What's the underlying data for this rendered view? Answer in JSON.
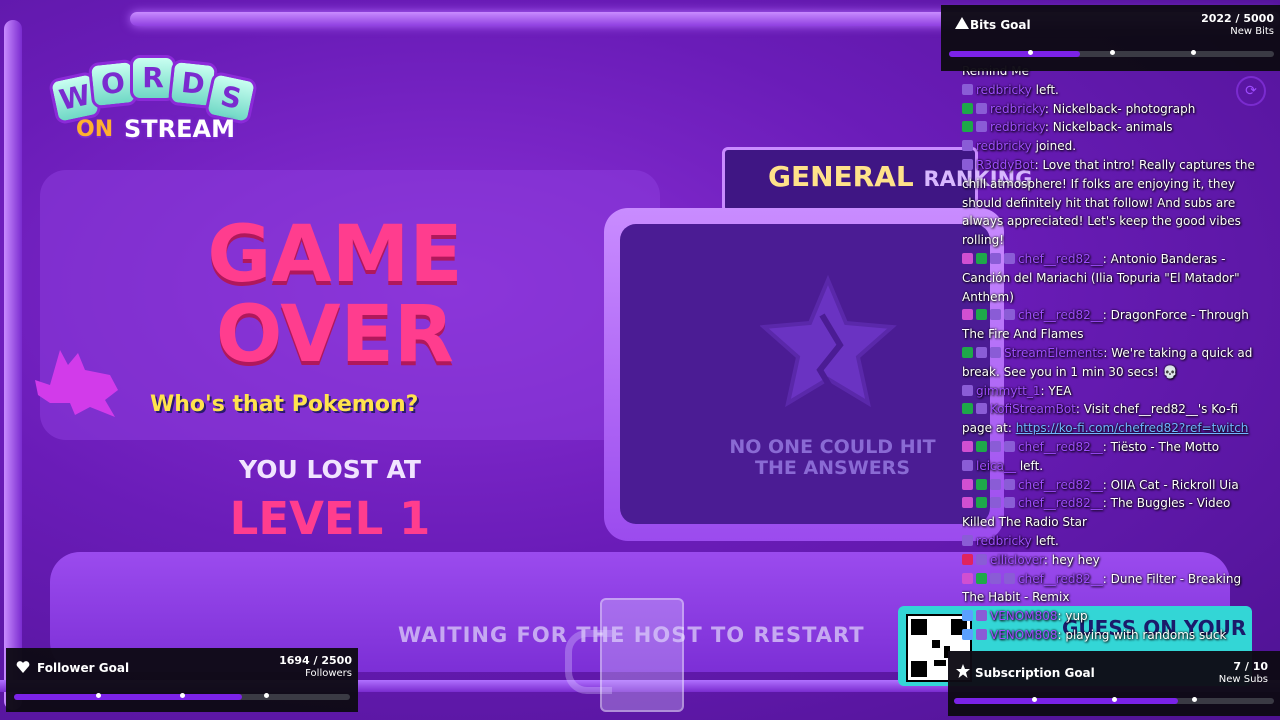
{
  "game": {
    "logo": {
      "letters": [
        "W",
        "O",
        "R",
        "D",
        "S"
      ],
      "on": "ON",
      "stream": "STREAM"
    },
    "game_over": "GAME OVER",
    "pokemon_overlay": "Who's that Pokemon?",
    "you_lost_at": "YOU LOST AT",
    "level": "LEVEL 1",
    "ranking_title": "GENERAL",
    "ranking_title_tail": "RANKING",
    "no_one_message": "NO ONE COULD HIT THE ANSWERS",
    "waiting_message": "WAITING FOR THE HOST TO RESTART",
    "promo_text": "GUESS ON YOUR"
  },
  "goals": {
    "bits": {
      "title": "Bits Goal",
      "current": "2022",
      "target": "5000",
      "unit": "New Bits",
      "progress": 0.4044,
      "ticks": [
        0.25,
        0.5,
        0.75
      ],
      "icon": "bits-icon"
    },
    "followers": {
      "title": "Follower Goal",
      "current": "1694",
      "target": "2500",
      "unit": "Followers",
      "progress": 0.6776,
      "ticks": [
        0.25,
        0.5,
        0.75
      ],
      "icon": "heart-icon"
    },
    "subs": {
      "title": "Subscription Goal",
      "current": "7",
      "target": "10",
      "unit": "New Subs",
      "progress": 0.7,
      "ticks": [
        0.25,
        0.5,
        0.75
      ],
      "icon": "star-icon"
    }
  },
  "chat": {
    "messages": [
      {
        "badges": [],
        "user": "",
        "sep": "",
        "text": "Remind Me"
      },
      {
        "badges": [
          "mod"
        ],
        "user": "redbricky",
        "sep": " ",
        "text": "left."
      },
      {
        "badges": [
          "check",
          "mod"
        ],
        "user": "redbricky",
        "sep": ": ",
        "text": "Nickelback- photograph"
      },
      {
        "badges": [
          "check",
          "mod"
        ],
        "user": "redbricky",
        "sep": ": ",
        "text": "Nickelback- animals"
      },
      {
        "badges": [
          "mod"
        ],
        "user": "redbricky",
        "sep": " ",
        "text": "joined."
      },
      {
        "badges": [
          "mod"
        ],
        "user": "R3ddyBot",
        "sep": ": ",
        "text": "Love that intro! Really captures the chill atmosphere! If folks are enjoying it, they should definitely hit that follow! And subs are always appreciated! Let's keep the good vibes rolling!"
      },
      {
        "badges": [
          "sub",
          "check",
          "mod",
          "mod"
        ],
        "user": "chef__red82__",
        "sep": ": ",
        "text": "Antonio Banderas - Canción del Mariachi (Ilia Topuria \"El Matador\" Anthem)"
      },
      {
        "badges": [
          "sub",
          "check",
          "mod",
          "mod"
        ],
        "user": "chef__red82__",
        "sep": ": ",
        "text": "DragonForce - Through The Fire And Flames"
      },
      {
        "badges": [
          "check",
          "mod",
          "mod"
        ],
        "user": "StreamElements",
        "sep": ": ",
        "text": "We're taking a quick ad break. See you in 1 min 30 secs! 💀"
      },
      {
        "badges": [
          "mod"
        ],
        "user": "gimmytt_1",
        "sep": ": ",
        "text": "YEA"
      },
      {
        "badges": [
          "check",
          "mod"
        ],
        "user": "KofiStreamBot",
        "sep": ": ",
        "text": "Visit chef__red82__'s Ko-fi page at: ",
        "link": "https://ko-fi.com/chefred82?ref=twitch"
      },
      {
        "badges": [
          "sub",
          "check",
          "mod",
          "mod"
        ],
        "user": "chef__red82__",
        "sep": ": ",
        "text": "Tiësto - The Motto"
      },
      {
        "badges": [
          "mod"
        ],
        "user": "leica__",
        "sep": " ",
        "text": "left."
      },
      {
        "badges": [
          "sub",
          "check",
          "mod",
          "mod"
        ],
        "user": "chef__red82__",
        "sep": ": ",
        "text": "OIIA Cat - Rickroll Uia"
      },
      {
        "badges": [
          "sub",
          "check",
          "mod",
          "mod"
        ],
        "user": "chef__red82__",
        "sep": ": ",
        "text": "The Buggles - Video Killed The Radio Star"
      },
      {
        "badges": [
          "mod"
        ],
        "user": "redbricky",
        "sep": " ",
        "text": "left."
      },
      {
        "badges": [
          "heart",
          "mod"
        ],
        "user": "elliclover",
        "sep": ": ",
        "text": "hey hey"
      },
      {
        "badges": [
          "sub",
          "check",
          "mod",
          "mod"
        ],
        "user": "chef__red82__",
        "sep": ": ",
        "text": "Dune Filter - Breaking The Habit - Remix"
      },
      {
        "badges": [
          "vip",
          "mod"
        ],
        "user": "VENOM808",
        "sep": ": ",
        "text": "yup"
      },
      {
        "badges": [
          "vip",
          "mod"
        ],
        "user": "VENOM808",
        "sep": ": ",
        "text": "playing with randoms suck"
      }
    ]
  },
  "colors": {
    "accent": "#7b22e8",
    "game_over": "#ff3d8e",
    "ranking_title": "#ffe28a",
    "username": "#9f4cff",
    "link": "#6fb5ff"
  }
}
